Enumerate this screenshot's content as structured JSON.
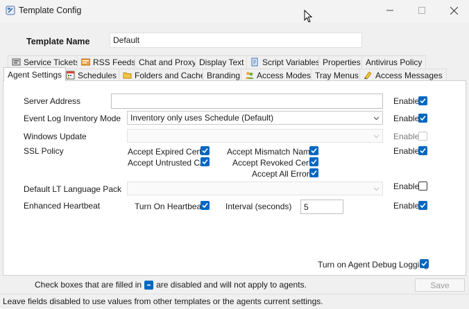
{
  "window": {
    "title": "Template Config",
    "icons": {
      "app": "template-config-app-icon",
      "minimize": "minimize-icon",
      "maximize": "maximize-icon",
      "close": "close-icon"
    }
  },
  "template": {
    "name_label": "Template Name",
    "name_value": "Default"
  },
  "tabs_row1": [
    {
      "label": "Service Tickets",
      "icon": "ticket-icon"
    },
    {
      "label": "RSS Feeds",
      "icon": "rss-icon"
    },
    {
      "label": "Chat and Proxy"
    },
    {
      "label": "Display Text"
    },
    {
      "label": "Script Variables",
      "icon": "script-icon"
    },
    {
      "label": "Properties"
    },
    {
      "label": "Antivirus Policy"
    }
  ],
  "tabs_row2": [
    {
      "label": "Agent Settings",
      "active": true
    },
    {
      "label": "Schedules",
      "icon": "schedule-icon"
    },
    {
      "label": "Folders and Cache",
      "icon": "folder-icon"
    },
    {
      "label": "Branding"
    },
    {
      "label": "Access Modes",
      "icon": "users-icon"
    },
    {
      "label": "Tray Menus"
    },
    {
      "label": "Access Messages",
      "icon": "message-icon"
    }
  ],
  "agent_settings": {
    "server_address": {
      "label": "Server Address",
      "value": "",
      "enable_label": "Enable",
      "enabled": true
    },
    "event_log": {
      "label": "Event Log Inventory Mode",
      "value": "Inventory only uses Schedule (Default)",
      "enable_label": "Enable",
      "enabled": true
    },
    "windows_update": {
      "label": "Windows Update",
      "value": "",
      "enable_label": "Enable",
      "enabled": false
    },
    "ssl_policy": {
      "label": "SSL Policy",
      "enable_label": "Enable",
      "enabled": true,
      "options": [
        {
          "label": "Accept Expired Certs",
          "checked": true
        },
        {
          "label": "Accept Untrusted CA",
          "checked": true
        },
        {
          "label": "Accept Mismatch Names",
          "checked": true
        },
        {
          "label": "Accept Revoked Certs",
          "checked": true
        },
        {
          "label": "Accept All Errors",
          "checked": true
        }
      ]
    },
    "language_pack": {
      "label": "Default LT Language Pack",
      "value": "",
      "enable_label": "Enable",
      "enabled": false
    },
    "heartbeat": {
      "label": "Enhanced Heartbeat",
      "turn_on_label": "Turn On Heartbeat",
      "turn_on": true,
      "interval_label": "Interval (seconds)",
      "interval_value": "5",
      "enable_label": "Enable",
      "enabled": true
    },
    "debug_logging": {
      "label": "Turn on Agent Debug Logging",
      "checked": true
    }
  },
  "footer": {
    "note_prefix": "Check boxes that are filled in",
    "note_suffix": "are disabled and will not apply to agents.",
    "save_label": "Save",
    "status": "Leave fields disabled to use values from other templates or the agents current settings."
  },
  "colors": {
    "accent": "#0067c0",
    "panel_bg": "#ffffff",
    "window_bg": "#f0f0f0"
  }
}
